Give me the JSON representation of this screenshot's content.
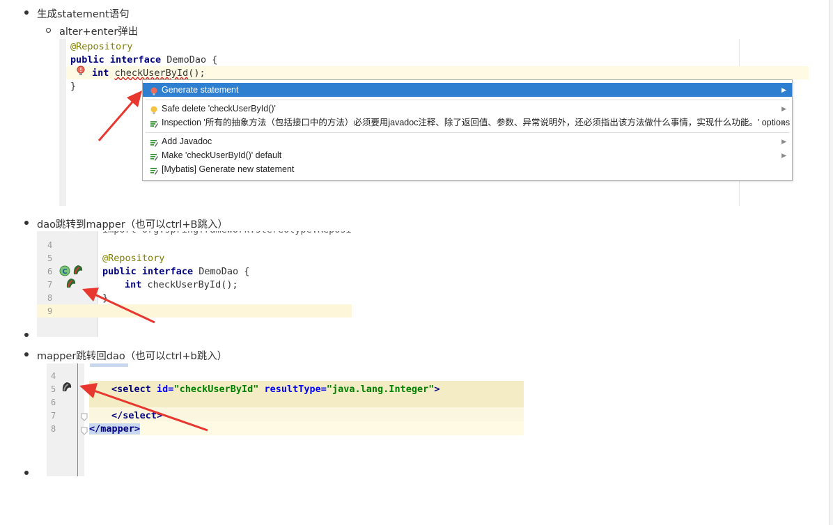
{
  "sections": [
    {
      "label": "生成statement语句",
      "sub_label": "alter+enter弹出"
    },
    {
      "label": "dao跳转到mapper（也可以ctrl+B跳入）"
    },
    {
      "label": "mapper跳转回dao（也可以ctrl+b跳入）"
    }
  ],
  "editor1": {
    "annotation": "@Repository",
    "kw_public": "public",
    "kw_interface": "interface",
    "class_name": "DemoDao {",
    "kw_int": "int",
    "method": "checkUserById",
    "method_tail": "();",
    "close_brace": "}"
  },
  "popup": {
    "items": [
      {
        "label": "Generate statement",
        "selected": true
      },
      {
        "label": "Safe delete 'checkUserById()'"
      },
      {
        "label": "Inspection '所有的抽象方法（包括接口中的方法）必须要用javadoc注释、除了返回值、参数、异常说明外，还必须指出该方法做什么事情，实现什么功能。' options"
      },
      {
        "label": "Add Javadoc"
      },
      {
        "label": "Make 'checkUserById()' default"
      },
      {
        "label": "[Mybatis] Generate new statement"
      }
    ]
  },
  "editor2": {
    "line_numbers": [
      "4",
      "5",
      "6",
      "7",
      "8",
      "9"
    ],
    "annotation": "@Repository",
    "kw_public": "public",
    "kw_interface": "interface",
    "class_name": "DemoDao {",
    "kw_int": "int",
    "method_line": "checkUserById();",
    "close_brace": "}"
  },
  "editor3": {
    "line_numbers": [
      "4",
      "5",
      "6",
      "7",
      "8"
    ],
    "select_open": "<select",
    "attr_id": "id=",
    "val_id": "\"checkUserById\"",
    "attr_result": "resultType=",
    "val_result": "\"java.lang.Integer\"",
    "tag_end": ">",
    "select_close": "</select>",
    "mapper_close": "</mapper>"
  },
  "colors": {
    "accent_selection": "#2f7fd0",
    "arrow": "#e8372f",
    "annotation": "#808000",
    "keyword": "#000080",
    "xml_string": "#008000"
  }
}
